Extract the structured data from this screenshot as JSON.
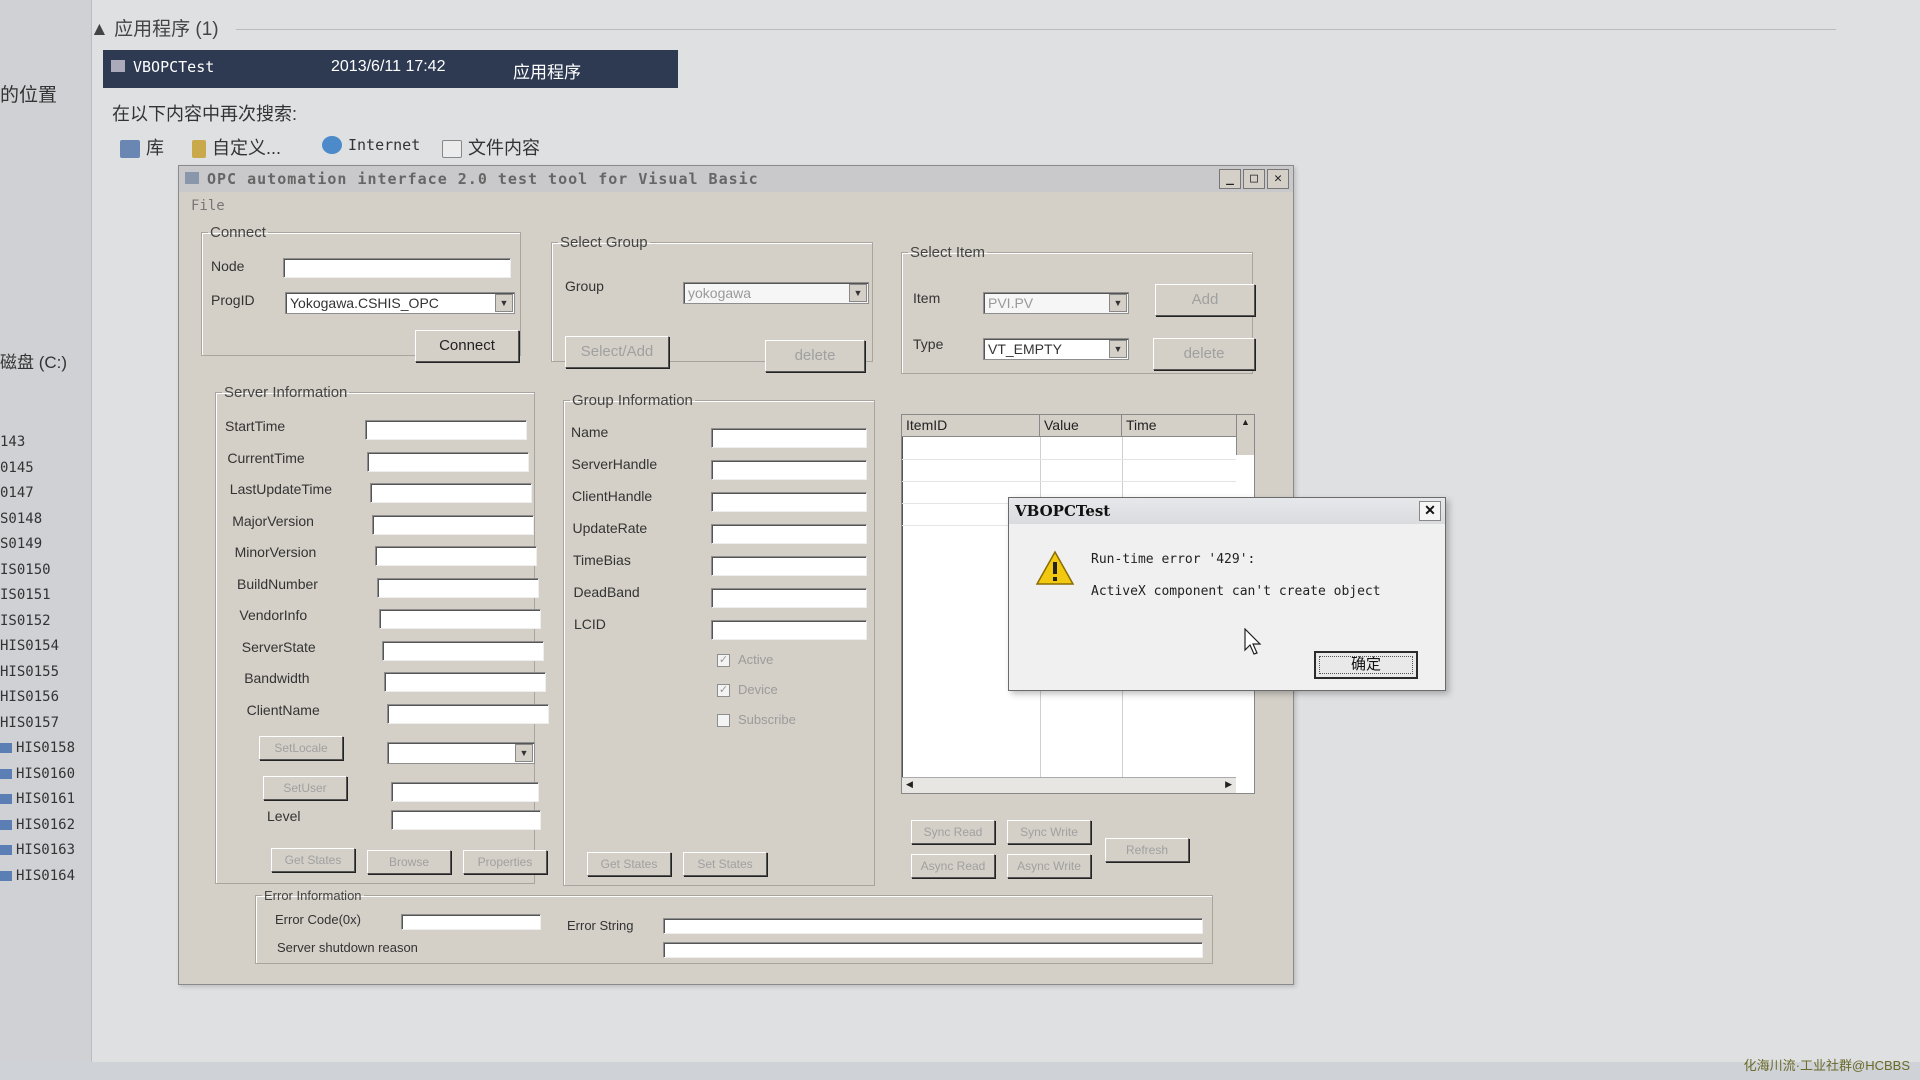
{
  "explorer": {
    "group_header": "应用程序 (1)",
    "left_label": "的位置",
    "drive_label": "磁盘 (C:)",
    "tree_items": [
      "143",
      "0145",
      "0147",
      "S0148",
      "S0149",
      "IS0150",
      "IS0151",
      "IS0152",
      "HIS0154",
      "HIS0155",
      "HIS0156",
      "HIS0157",
      "HIS0158",
      "HIS0160",
      "HIS0161",
      "HIS0162",
      "HIS0163",
      "HIS0164"
    ],
    "result": {
      "name": "VBOPCTest",
      "date": "2013/6/11 17:42",
      "type": "应用程序"
    },
    "research_label": "在以下内容中再次搜索:",
    "scope_items": [
      "库",
      "自定义...",
      "Internet",
      "文件内容"
    ]
  },
  "window": {
    "title": "OPC automation interface 2.0 test tool for Visual Basic",
    "menu_file": "File",
    "connect": {
      "legend": "Connect",
      "node_label": "Node",
      "progid_label": "ProgID",
      "progid_value": "Yokogawa.CSHIS_OPC",
      "connect_button": "Connect"
    },
    "select_group": {
      "legend": "Select Group",
      "group_label": "Group",
      "group_value": "yokogawa",
      "select_add_button": "Select/Add",
      "delete_button": "delete"
    },
    "select_item": {
      "legend": "Select Item",
      "item_label": "Item",
      "item_value": "PVI.PV",
      "type_label": "Type",
      "type_value": "VT_EMPTY",
      "add_button": "Add",
      "delete_button": "delete"
    },
    "server_info": {
      "legend": "Server Information",
      "fields": [
        "StartTime",
        "CurrentTime",
        "LastUpdateTime",
        "MajorVersion",
        "MinorVersion",
        "BuildNumber",
        "VendorInfo",
        "ServerState",
        "Bandwidth",
        "ClientName"
      ],
      "setlocale_button": "SetLocale",
      "setuser_button": "SetUser",
      "level_label": "Level",
      "get_states_button": "Get States",
      "browse_button": "Browse",
      "properties_button": "Properties"
    },
    "group_info": {
      "legend": "Group Information",
      "fields": [
        "Name",
        "ServerHandle",
        "ClientHandle",
        "UpdateRate",
        "TimeBias",
        "DeadBand",
        "LCID"
      ],
      "active_label": "Active",
      "device_label": "Device",
      "subscribe_label": "Subscribe",
      "get_states_button": "Get States",
      "set_states_button": "Set States"
    },
    "item_grid": {
      "columns": [
        "ItemID",
        "Value",
        "Time"
      ],
      "sync_read": "Sync Read",
      "sync_write": "Sync Write",
      "async_read": "Async Read",
      "async_write": "Async Write",
      "refresh": "Refresh"
    },
    "error_info": {
      "legend": "Error Information",
      "error_code_label": "Error Code(0x)",
      "error_string_label": "Error String",
      "shutdown_label": "Server shutdown reason"
    }
  },
  "dialog": {
    "title": "VBOPCTest",
    "line1": "Run-time error '429':",
    "line2": "ActiveX component can't create object",
    "ok_button": "确定"
  },
  "watermark": "化海川流·工业社群@HCBBS",
  "colors": {
    "result_bg": "#2e3a52",
    "window_bg": "#d4d0c8",
    "warning": "#f2c811"
  }
}
